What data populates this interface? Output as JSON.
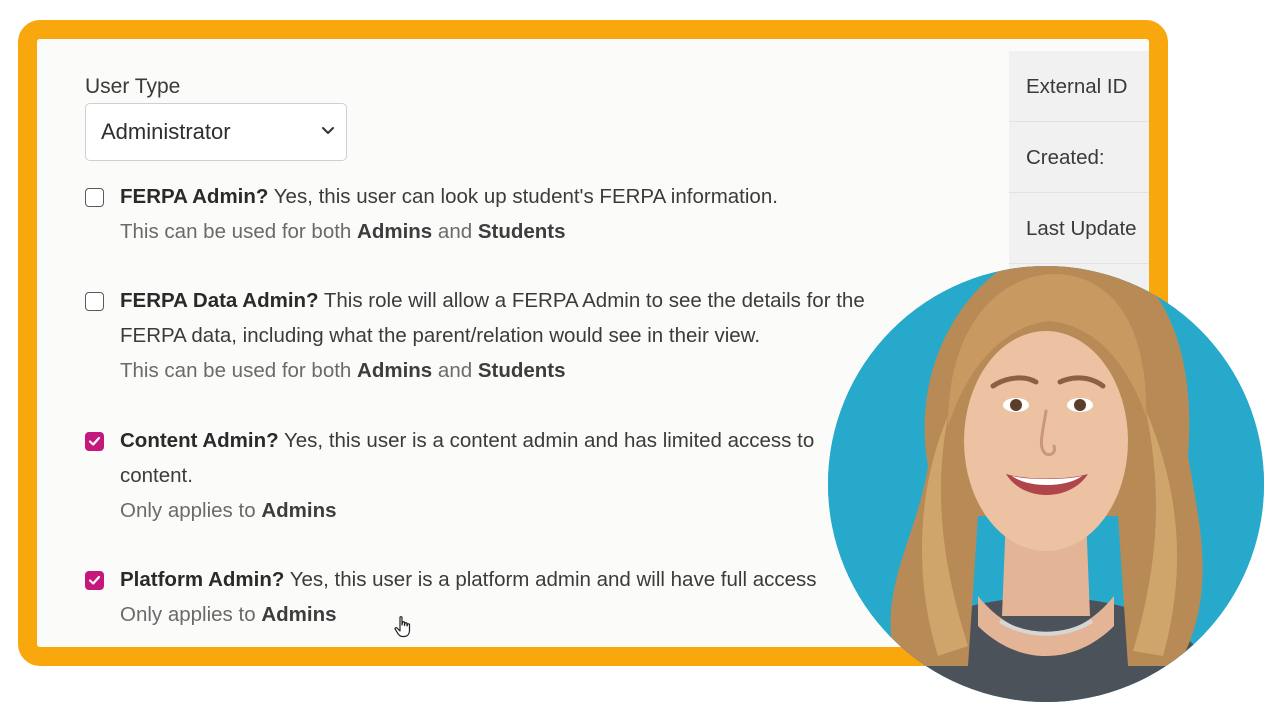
{
  "form": {
    "user_type_label": "User Type",
    "user_type_value": "Administrator",
    "options": [
      {
        "title": "FERPA Admin?",
        "desc": " Yes, this user can look up student's FERPA information.",
        "note_prefix": "This can be used for both ",
        "note_b1": "Admins",
        "note_mid": " and ",
        "note_b2": "Students",
        "checked": false
      },
      {
        "title": "FERPA Data Admin?",
        "desc": " This role will allow a FERPA Admin to see the details for the FERPA data, including what the parent/relation would see in their view.",
        "note_prefix": "This can be used for both ",
        "note_b1": "Admins",
        "note_mid": " and ",
        "note_b2": "Students",
        "checked": false
      },
      {
        "title": "Content Admin?",
        "desc": " Yes, this user is a content admin and has limited access to content.",
        "note_prefix": "Only applies to ",
        "note_b1": "Admins",
        "checked": true
      },
      {
        "title": "Platform Admin?",
        "desc": " Yes, this user is a platform admin and will have full access",
        "note_prefix": "Only applies to ",
        "note_b1": "Admins",
        "checked": true
      }
    ]
  },
  "details": {
    "rows": [
      "External ID",
      "Created:",
      "Last Update"
    ]
  },
  "colors": {
    "frame": "#F8A80C",
    "checkbox_checked": "#c4187c",
    "avatar_bg": "#27a9cc"
  },
  "icons": [
    "chevron-down-icon",
    "checkmark-icon",
    "hand-pointer-icon"
  ]
}
